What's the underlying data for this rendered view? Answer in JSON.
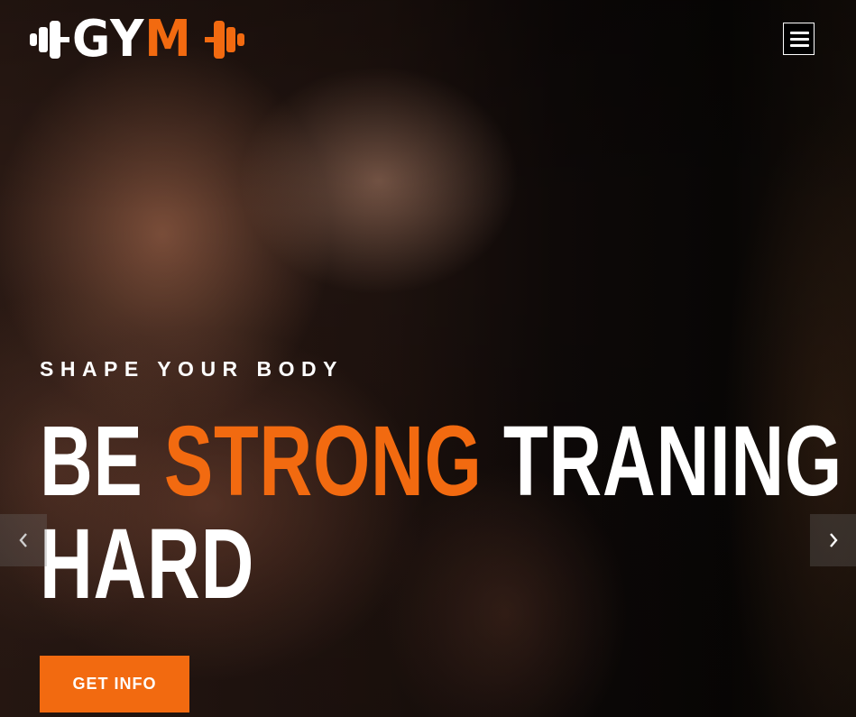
{
  "header": {
    "logo": {
      "text_left": "GY",
      "text_accent": "M"
    },
    "menu_icon": "hamburger-menu-icon"
  },
  "hero": {
    "kicker": "SHAPE YOUR BODY",
    "headline": {
      "word1": "BE",
      "accent": "STRONG",
      "word3": "TRANING",
      "line2": "HARD"
    },
    "cta_label": "GET INFO"
  },
  "slider": {
    "prev_icon": "chevron-left-icon",
    "next_icon": "chevron-right-icon"
  },
  "colors": {
    "accent": "#f26a10",
    "text": "#ffffff",
    "background": "#0b0807"
  }
}
